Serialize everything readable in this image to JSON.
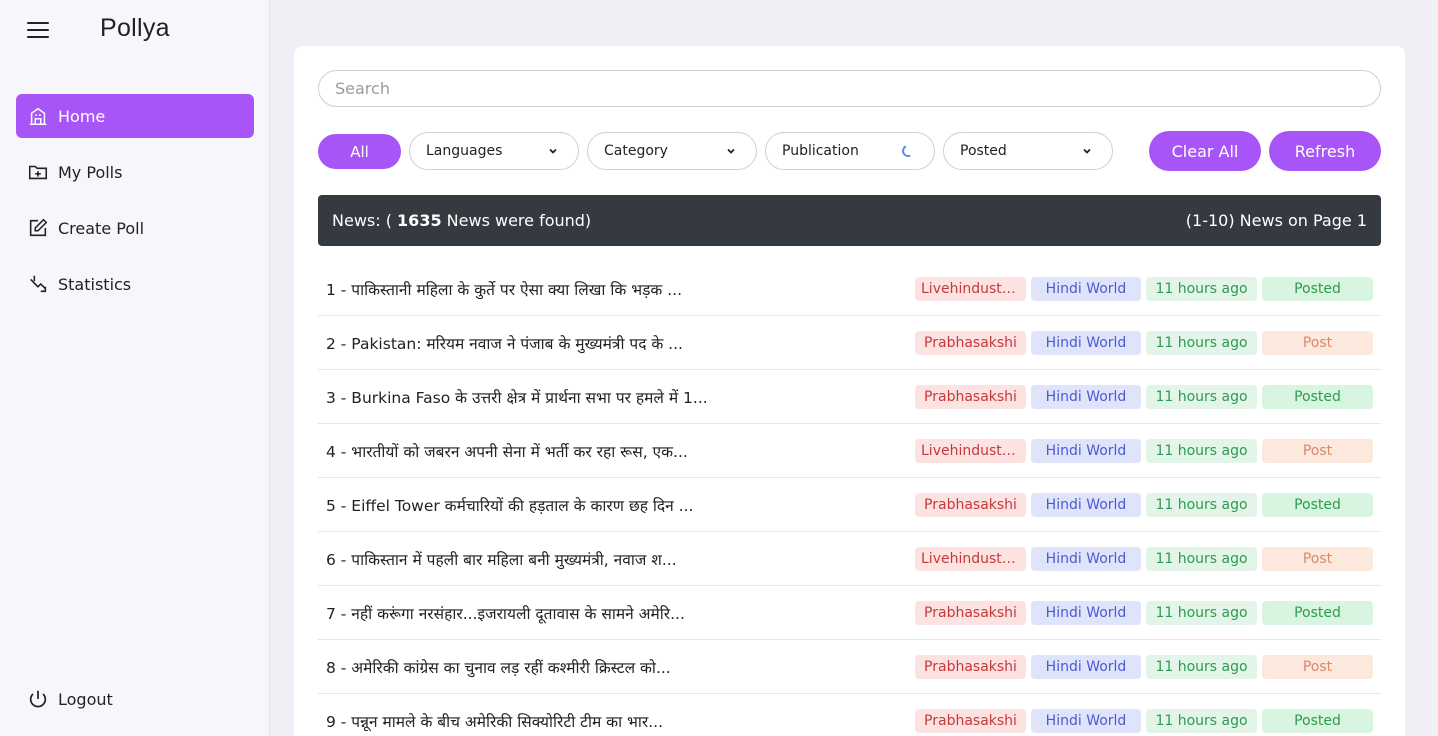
{
  "app": {
    "brand": "Pollya"
  },
  "sidebar": {
    "items": [
      {
        "label": "Home",
        "icon": "home-icon",
        "active": true
      },
      {
        "label": "My Polls",
        "icon": "folder-plus-icon",
        "active": false
      },
      {
        "label": "Create Poll",
        "icon": "edit-icon",
        "active": false
      },
      {
        "label": "Statistics",
        "icon": "statistics-icon",
        "active": false
      }
    ],
    "logout": "Logout"
  },
  "search": {
    "placeholder": "Search",
    "value": ""
  },
  "filters": {
    "all": "All",
    "languages": "Languages",
    "category": "Category",
    "publication": "Publication",
    "posted": "Posted",
    "clear_all": "Clear All",
    "refresh": "Refresh"
  },
  "banner": {
    "prefix": "News: ( ",
    "count": "1635",
    "suffix": " News were found)",
    "page_info": "(1-10) News on Page 1"
  },
  "colors": {
    "accent": "#a855f7",
    "banner_bg": "#343a40"
  },
  "news": [
    {
      "title": "1 - पाकिस्तानी महिला के कुर्ते पर ऐसा क्या लिखा कि भड़क ...",
      "publication": "Livehindusta...",
      "category": "Hindi World",
      "time": "11 hours ago",
      "status": "Posted"
    },
    {
      "title": "2 - Pakistan: मरियम नवाज ने पंजाब के मुख्यमंत्री पद के ...",
      "publication": "Prabhasakshi",
      "category": "Hindi World",
      "time": "11 hours ago",
      "status": "Post"
    },
    {
      "title": "3 - Burkina Faso के उत्तरी क्षेत्र में प्रार्थना सभा पर हमले में 1...",
      "publication": "Prabhasakshi",
      "category": "Hindi World",
      "time": "11 hours ago",
      "status": "Posted"
    },
    {
      "title": "4 - भारतीयों को जबरन अपनी सेना में भर्ती कर रहा रूस, एक...",
      "publication": "Livehindusta...",
      "category": "Hindi World",
      "time": "11 hours ago",
      "status": "Post"
    },
    {
      "title": "5 - Eiffel Tower कर्मचारियों की हड़ताल के कारण छह दिन ...",
      "publication": "Prabhasakshi",
      "category": "Hindi World",
      "time": "11 hours ago",
      "status": "Posted"
    },
    {
      "title": "6 - पाकिस्तान में पहली बार महिला बनी मुख्यमंत्री, नवाज श...",
      "publication": "Livehindusta...",
      "category": "Hindi World",
      "time": "11 hours ago",
      "status": "Post"
    },
    {
      "title": "7 - नहीं करूंगा नरसंहार...इजरायली दूतावास के सामने अमेरि...",
      "publication": "Prabhasakshi",
      "category": "Hindi World",
      "time": "11 hours ago",
      "status": "Posted"
    },
    {
      "title": "8 - अमेरिकी कांग्रेस का चुनाव लड़ रहीं कश्मीरी क्रिस्टल को...",
      "publication": "Prabhasakshi",
      "category": "Hindi World",
      "time": "11 hours ago",
      "status": "Post"
    },
    {
      "title": "9 - पन्नून मामले के बीच अमेरिकी सिक्योरिटी टीम का भार...",
      "publication": "Prabhasakshi",
      "category": "Hindi World",
      "time": "11 hours ago",
      "status": "Posted"
    }
  ]
}
